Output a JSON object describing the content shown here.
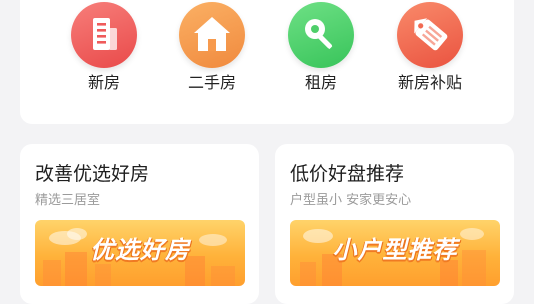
{
  "nav": {
    "items": [
      {
        "label": "新房",
        "icon": "building-icon",
        "color": "#ef5b5b"
      },
      {
        "label": "二手房",
        "icon": "house-icon",
        "color": "#f79a4d"
      },
      {
        "label": "租房",
        "icon": "key-icon",
        "color": "#4fcf6a"
      },
      {
        "label": "新房补贴",
        "icon": "tag-icon",
        "color": "#f26a52"
      }
    ]
  },
  "cards": [
    {
      "title": "改善优选好房",
      "subtitle": "精选三居室",
      "banner": "优选好房"
    },
    {
      "title": "低价好盘推荐",
      "subtitle": "户型虽小 安家更安心",
      "banner": "小户型推荐"
    }
  ],
  "colors": {
    "banner": "#ffb23a",
    "page_bg": "#f3f3f5"
  }
}
